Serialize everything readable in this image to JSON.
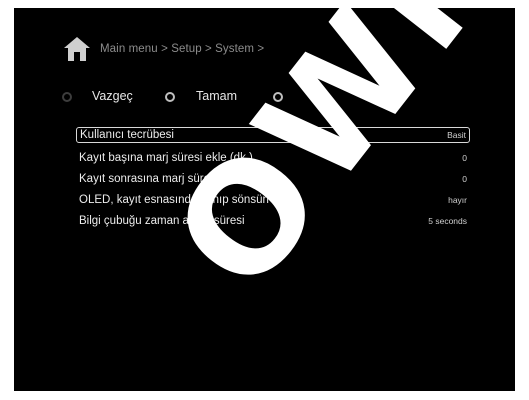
{
  "header": {
    "breadcrumb": "Main menu > Setup > System >",
    "icon": "home-icon"
  },
  "buttons": [
    {
      "label": "Vazgeç",
      "state": "dim"
    },
    {
      "label": "Tamam",
      "state": "lit"
    }
  ],
  "extra_radios": [
    "lit",
    "lit"
  ],
  "settings": [
    {
      "label": "Kullanıcı tecrübesi",
      "value": "Basit",
      "selected": true
    },
    {
      "label": "Kayıt başına marj süresi ekle (dk.)",
      "value": "0"
    },
    {
      "label": "Kayıt sonrasına marj süresi ekle (dk.)",
      "value": "0"
    },
    {
      "label": "OLED, kayıt esnasında yanıp sönsün",
      "value": "hayır"
    },
    {
      "label": "Bilgi çubuğu zaman aşımı süresi",
      "value": "5 seconds"
    }
  ],
  "watermark": {
    "text": "OWNLOA",
    "color": "#ffffff"
  }
}
